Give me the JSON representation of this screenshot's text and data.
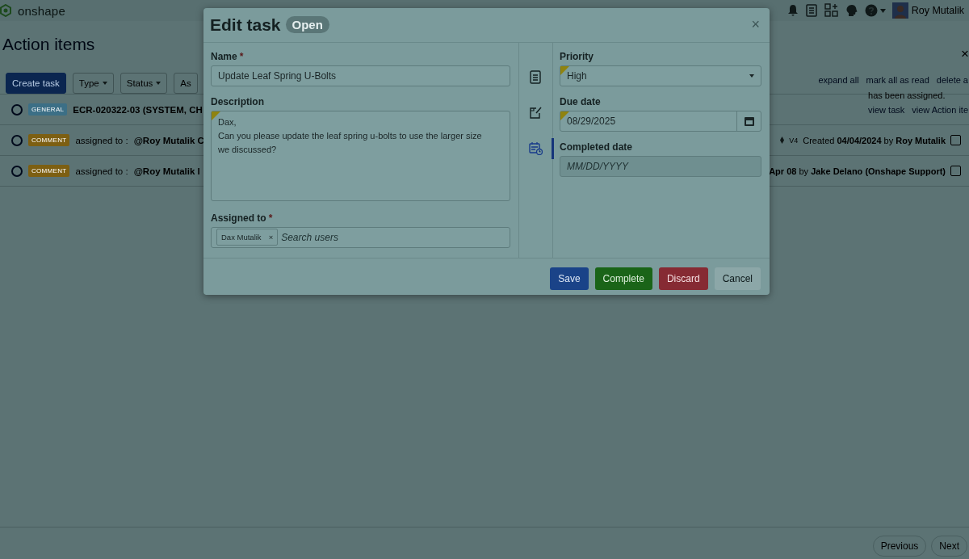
{
  "top_bar": {
    "logo": "onshape",
    "user": "Roy Mutalik"
  },
  "page": {
    "title": "Action items",
    "panel_close": "×",
    "toolbar": [
      {
        "label": "Create task",
        "kind": "primary"
      },
      {
        "label": "Type",
        "kind": "dropdown"
      },
      {
        "label": "Status",
        "kind": "dropdown"
      },
      {
        "label": "As",
        "kind": "plain"
      }
    ],
    "links": [
      "expand all",
      "mark all as read",
      "delete a"
    ],
    "items": [
      {
        "tag": "GENERAL",
        "color": "#3c6f86",
        "title": "ECR-020322-03 (SYSTEM, CH",
        "completed": false,
        "message": "has been assigned.",
        "links": [
          "view task",
          "view Action ite"
        ]
      },
      {
        "tag": "COMMENT",
        "color": "#7d5f12",
        "prefix": "assigned to :",
        "title": "@Roy Mutalik C",
        "completed": false,
        "version": "V4",
        "meta": "Created **04/04/2024** by **Roy Mutalik**",
        "checked": false
      },
      {
        "tag": "COMMENT",
        "color": "#7d5f12",
        "prefix": "assigned to :",
        "title": "@Roy Mutalik l",
        "completed": false,
        "meta": "**Apr 08** by **Jake Delano (Onshape Support)**",
        "checked": false
      }
    ],
    "pagination": [
      "Previous",
      "Next"
    ]
  },
  "dialog": {
    "title": "Edit task",
    "status": "Open",
    "close": "×",
    "name": {
      "label": "Name",
      "mark": "*",
      "value": "Update Leaf Spring U-Bolts",
      "flagged": false
    },
    "description": {
      "label": "Description",
      "value": "Dax,\nCan you please update the leaf spring u-bolts to use the larger size\nwe discussed?",
      "flagged": true
    },
    "assigned": {
      "label": "Assigned to",
      "mark": "*",
      "chips": [
        {
          "name": "Dax Mutalik",
          "remove": "×"
        }
      ],
      "placeholder": "Search users"
    },
    "side_tabs": [
      {
        "kind": "details",
        "selected": false
      },
      {
        "kind": "edit",
        "selected": false
      },
      {
        "kind": "schedule",
        "selected": true
      }
    ],
    "priority": {
      "label": "Priority",
      "value": "High",
      "flagged": true
    },
    "due_date": {
      "label": "Due date",
      "value": "08/29/2025",
      "flagged": true
    },
    "completed_date": {
      "label": "Completed date",
      "placeholder": "MM/DD/YYYY"
    },
    "buttons": [
      {
        "label": "Save",
        "kind": "primary"
      },
      {
        "label": "Complete",
        "kind": "success"
      },
      {
        "label": "Discard",
        "kind": "danger"
      },
      {
        "label": "Cancel",
        "kind": "secondary"
      }
    ]
  }
}
